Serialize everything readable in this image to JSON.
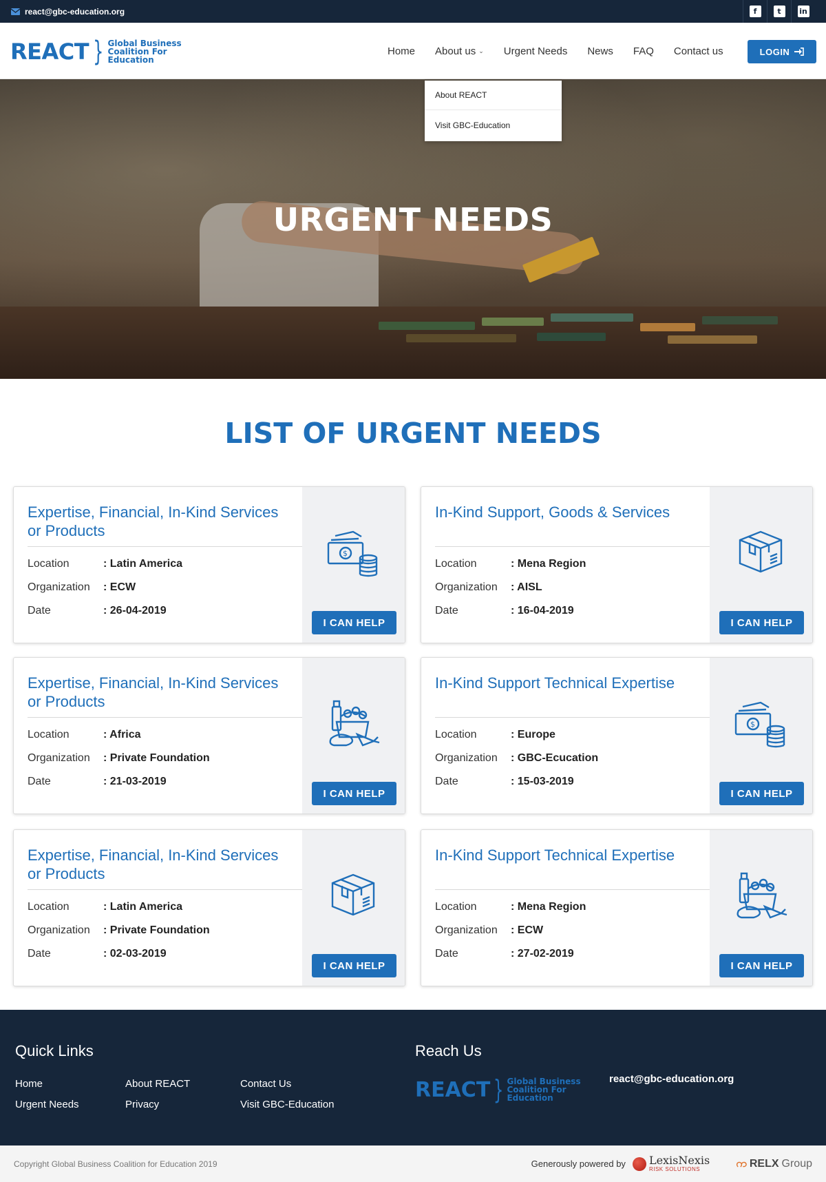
{
  "topbar": {
    "email": "react@gbc-education.org",
    "social": [
      "facebook-icon",
      "twitter-icon",
      "linkedin-icon"
    ]
  },
  "header": {
    "logo_big": "REACT",
    "logo_small": [
      "Global Business",
      "Coalition For",
      "Education"
    ],
    "nav": [
      {
        "label": "Home"
      },
      {
        "label": "About us"
      },
      {
        "label": "Urgent Needs"
      },
      {
        "label": "News"
      },
      {
        "label": "FAQ"
      },
      {
        "label": "Contact us"
      }
    ],
    "login_label": "LOGIN",
    "dropdown": [
      "About REACT",
      "Visit GBC-Education"
    ]
  },
  "hero": {
    "title": "URGENT NEEDS"
  },
  "section": {
    "title": "LIST OF URGENT NEEDS"
  },
  "labels": {
    "location": "Location",
    "organization": "Organization",
    "date": "Date",
    "help": "I CAN HELP"
  },
  "cards": [
    {
      "title": "Expertise, Financial, In-Kind Services or Products",
      "location": ": Latin America",
      "organization": ": ECW",
      "date": ": 26-04-2019",
      "icon": "money-icon"
    },
    {
      "title": "In-Kind Support, Goods & Services",
      "location": ": Mena Region",
      "organization": ": AISL",
      "date": ": 16-04-2019",
      "icon": "box-icon"
    },
    {
      "title": "Expertise, Financial, In-Kind Services or Products",
      "location": ": Africa",
      "organization": ": Private Foundation",
      "date": ": 21-03-2019",
      "icon": "groceries-icon"
    },
    {
      "title": "In-Kind Support Technical Expertise",
      "location": ": Europe",
      "organization": ": GBC-Ecucation",
      "date": ": 15-03-2019",
      "icon": "money-icon"
    },
    {
      "title": "Expertise, Financial, In-Kind Services or Products",
      "location": ": Latin America",
      "organization": ": Private Foundation",
      "date": ": 02-03-2019",
      "icon": "box-icon"
    },
    {
      "title": "In-Kind Support Technical Expertise",
      "location": ": Mena Region",
      "organization": ": ECW",
      "date": ": 27-02-2019",
      "icon": "groceries-icon"
    }
  ],
  "footer": {
    "quick_links_title": "Quick Links",
    "links": [
      "Home",
      "Urgent Needs",
      "About REACT",
      "Privacy",
      "Contact Us",
      "Visit GBC-Education"
    ],
    "reach_title": "Reach Us",
    "email": "react@gbc-education.org",
    "copyright": "Copyright Global Business Coalition for Education 2019",
    "powered_by": "Generously powered by",
    "lexis_name": "LexisNexis",
    "lexis_sub": "RISK SOLUTIONS",
    "relx": "RELX",
    "relx_group": "Group"
  }
}
